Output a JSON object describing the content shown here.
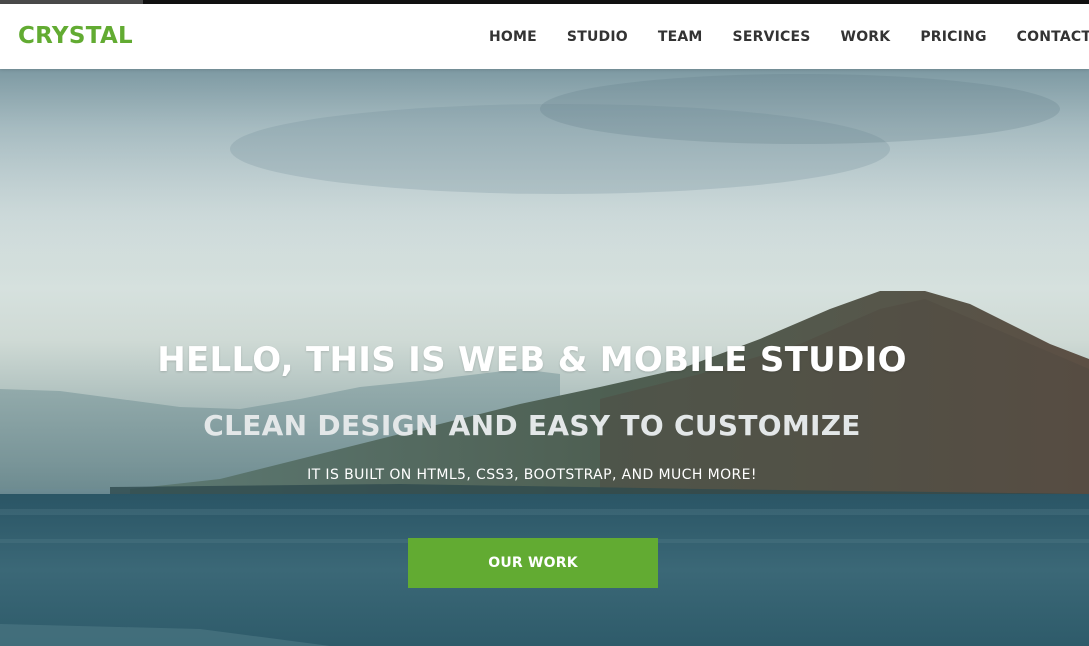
{
  "brand": {
    "name": "CRYSTAL"
  },
  "nav": {
    "items": [
      "HOME",
      "STUDIO",
      "TEAM",
      "SERVICES",
      "WORK",
      "PRICING",
      "CONTACT"
    ]
  },
  "hero": {
    "headline": "HELLO, THIS IS WEB & MOBILE STUDIO",
    "subheadline": "CLEAN DESIGN AND EASY TO CUSTOMIZE",
    "tagline": "IT IS BUILT ON HTML5, CSS3, BOOTSTRAP, AND MUCH MORE!",
    "cta_label": "OUR WORK"
  },
  "colors": {
    "accent": "#62ab32",
    "nav_text": "#333333",
    "header_bg": "#ffffff"
  }
}
